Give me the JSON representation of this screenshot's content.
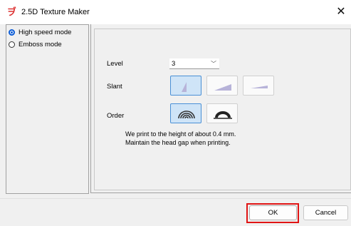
{
  "window": {
    "title": "2.5D Texture Maker",
    "app_icon": "app-icon",
    "close_icon": "close-icon"
  },
  "modes": [
    {
      "label": "High speed mode",
      "selected": true
    },
    {
      "label": "Emboss mode",
      "selected": false
    }
  ],
  "form": {
    "level_label": "Level",
    "level_value": "3",
    "slant_label": "Slant",
    "slant_options": [
      "steep-slant-icon",
      "medium-slant-icon",
      "gentle-slant-icon"
    ],
    "slant_selected": 0,
    "order_label": "Order",
    "order_options": [
      "layered-arch-icon",
      "dome-icon"
    ],
    "order_selected": 0
  },
  "info": {
    "line1": "We print to the height of about 0.4 mm.",
    "line2": "Maintain the head gap when printing."
  },
  "buttons": {
    "ok": "OK",
    "cancel": "Cancel"
  },
  "colors": {
    "accent": "#0a5bd6",
    "selected_button": "#cfe4f7",
    "highlight": "#e01414",
    "shape_fill": "#b7b3d9"
  }
}
